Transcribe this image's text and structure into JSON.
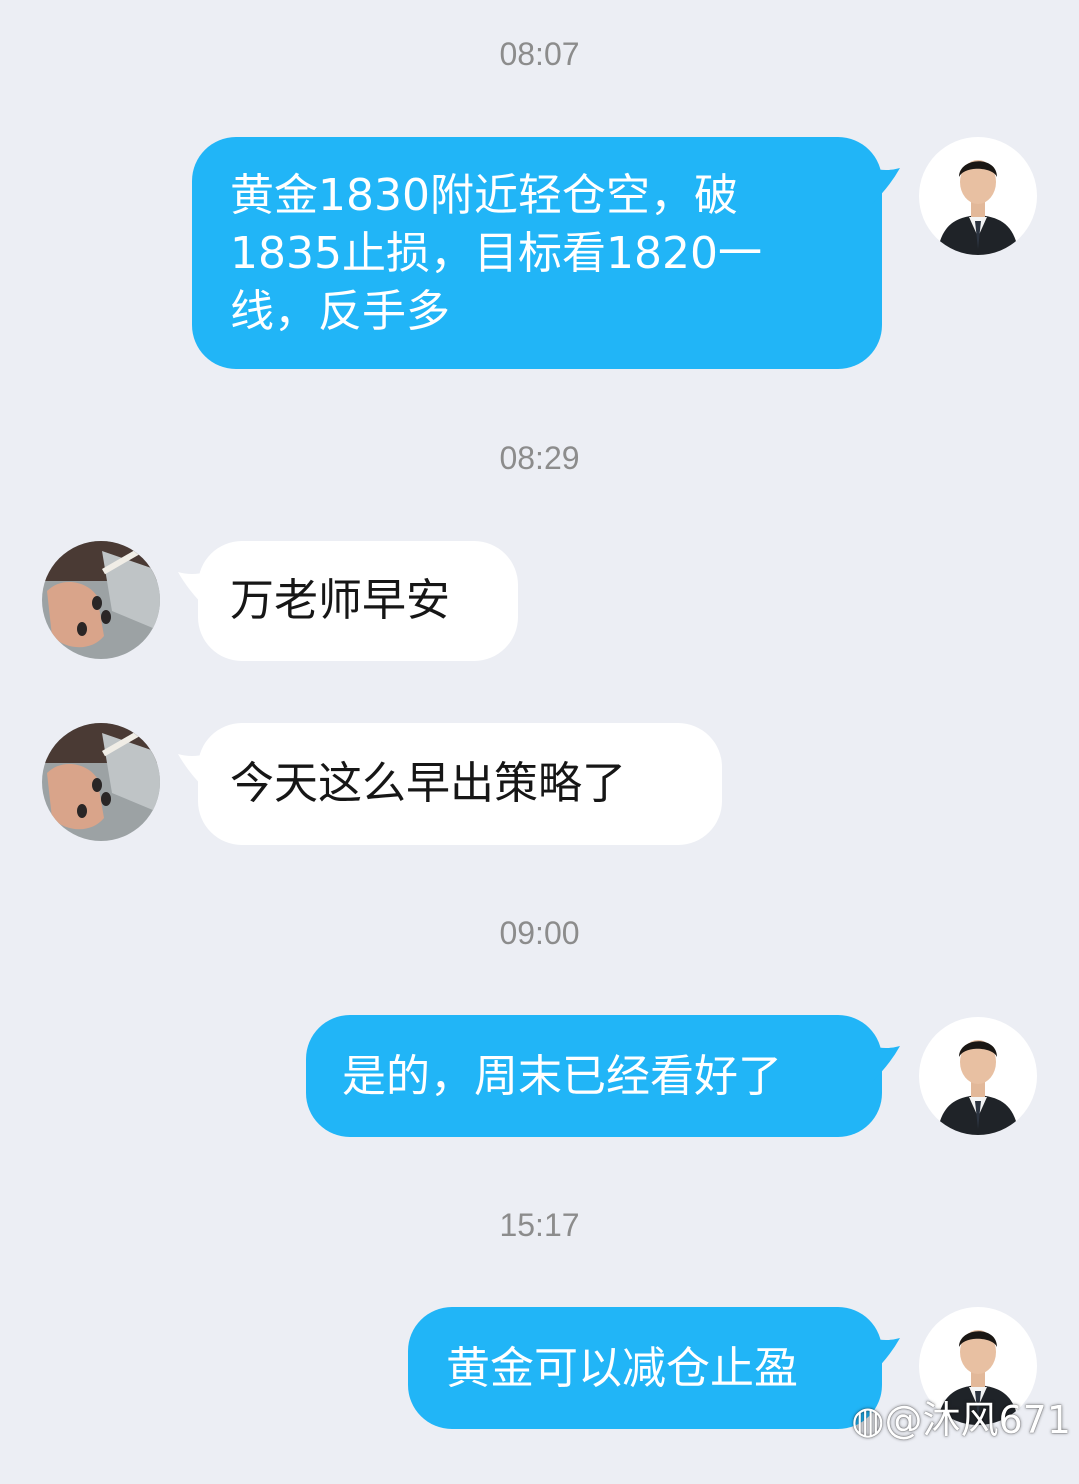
{
  "messages": [
    {
      "time": "08:07",
      "sender": "teacher",
      "text": "黄金1830附近轻仓空，破1835止损，目标看1820一线，反手多"
    },
    {
      "time": "08:29",
      "sender": "user",
      "text": "万老师早安"
    },
    {
      "sender": "user",
      "text": "今天这么早出策略了"
    },
    {
      "time": "09:00",
      "sender": "teacher",
      "text": "是的，周末已经看好了"
    },
    {
      "time": "15:17",
      "sender": "teacher",
      "text": "黄金可以减仓止盈"
    }
  ],
  "watermark": "@沐风671",
  "colors": {
    "background": "#eceef4",
    "outgoing_bubble": "#21b5f7",
    "incoming_bubble": "#ffffff",
    "timestamp": "#8c8c8c"
  }
}
